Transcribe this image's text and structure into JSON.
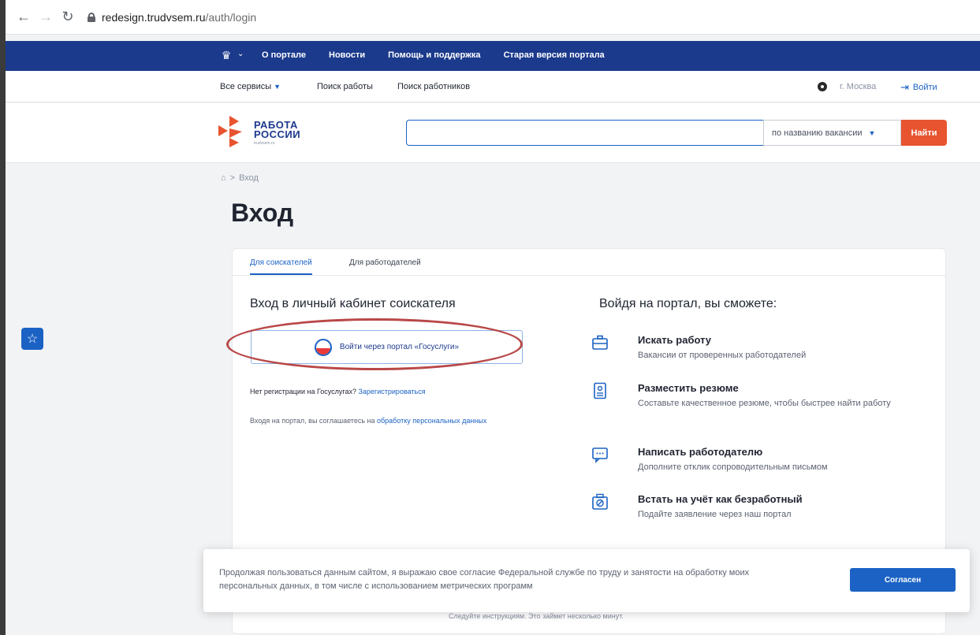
{
  "browser": {
    "host": "redesign.trudvsem.ru",
    "path": "/auth/login"
  },
  "topnav": {
    "links": [
      "О портале",
      "Новости",
      "Помощь и поддержка",
      "Старая версия портала"
    ]
  },
  "servicebar": {
    "all_services": "Все сервисы",
    "job_search": "Поиск работы",
    "worker_search": "Поиск работников",
    "city": "г. Москва",
    "login": "Войти"
  },
  "header": {
    "logo_line1": "РАБОТА",
    "logo_line2": "РОССИИ",
    "logo_sub": "trudvsem.ru",
    "search_placeholder": "",
    "search_mode": "по названию вакансии",
    "search_button": "Найти"
  },
  "breadcrumb": {
    "current": "Вход"
  },
  "page_title": "Вход",
  "tabs": [
    "Для соискателей",
    "Для работодателей"
  ],
  "login_section": {
    "title": "Вход в личный кабинет соискателя",
    "gosuslugi_button": "Войти через портал «Госуслуги»",
    "no_registration": "Нет регистрации на Госуслугах?",
    "register_link": "Зарегистрироваться",
    "agree_text": "Входя на портал, вы соглашаетесь на",
    "agree_link": "обработку персональных данных"
  },
  "benefits": {
    "title": "Войдя на портал, вы сможете:",
    "items": [
      {
        "title": "Искать работу",
        "desc": "Вакансии от проверенных работодателей",
        "icon": "briefcase-icon"
      },
      {
        "title": "Разместить резюме",
        "desc": "Составьте качественное резюме, чтобы быстрее найти работу",
        "icon": "resume-icon"
      },
      {
        "title": "Написать работодателю",
        "desc": "Дополните отклик сопроводительным письмом",
        "icon": "message-icon"
      },
      {
        "title": "Встать на учёт как безработный",
        "desc": "Подайте заявление через наш портал",
        "icon": "application-icon"
      }
    ]
  },
  "cookie": {
    "text": "Продолжая пользоваться данным сайтом, я выражаю свое согласие Федеральной службе по труду и занятости на обработку моих персональных данных, в том числе с использованием метрических программ",
    "button": "Согласен"
  },
  "under_text": "Следуйте инструкциям. Это займет несколько минут.",
  "colors": {
    "brand_blue": "#1b3a8c",
    "link_blue": "#1b62c4",
    "search_orange": "#e8542f",
    "highlight_red": "#b94848"
  }
}
